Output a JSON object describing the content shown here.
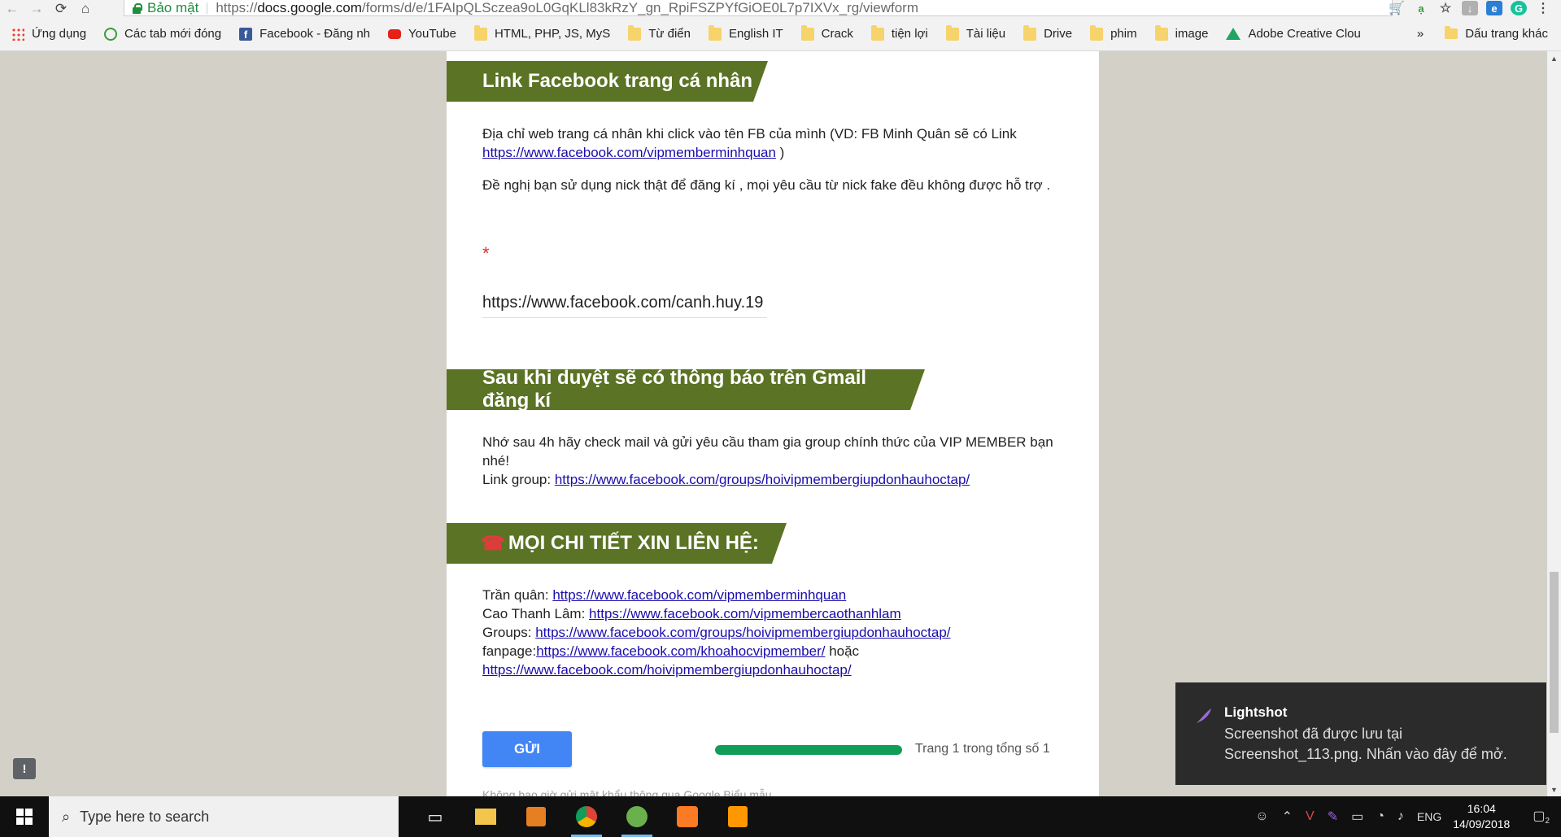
{
  "browser": {
    "secure_label": "Bảo mật",
    "url_scheme": "https://",
    "url_host": "docs.google.com",
    "url_path": "/forms/d/e/1FAIpQLSczea9oL0GqKLl83kRzY_gn_RpiFSZPYfGiOE0L7p7IXVx_rg/viewform"
  },
  "bookmarks": {
    "items": [
      "Ứng dụng",
      "Các tab mới đóng",
      "Facebook - Đăng nh",
      "YouTube",
      "HTML, PHP, JS, MyS",
      "Từ điển",
      "English IT",
      "Crack",
      "tiện lợi",
      "Tài liệu",
      "Drive",
      "phim",
      "image",
      "Adobe Creative Clou"
    ],
    "more": "»",
    "other": "Dấu trang khác"
  },
  "form": {
    "section1_title": "Link Facebook trang cá nhân",
    "section1_desc_a": " Địa chỉ web trang cá nhân khi click vào tên FB của mình (VD: FB Minh Quân  sẽ có Link ",
    "section1_link": "https://www.facebook.com/vipmemberminhquan",
    "section1_desc_b": " )",
    "section1_note": "Đề nghị bạn sử dụng nick thật để đăng kí , mọi yêu cầu từ nick fake đều không được hỗ trợ .",
    "required_mark": "*",
    "answer_value": "https://www.facebook.com/canh.huy.19",
    "section2_title": "Sau khi duyệt sẽ có thông báo trên Gmail đăng kí",
    "section2_text": "Nhớ sau 4h hãy check mail và gửi yêu cầu tham gia group chính thức của VIP MEMBER bạn nhé!",
    "section2_group_label": "Link group: ",
    "section2_group_link": "https://www.facebook.com/groups/hoivipmembergiupdonhauhoctap/",
    "section3_icon": "☎",
    "section3_title": "MỌI CHI TIẾT XIN LIÊN HỆ:",
    "contacts": [
      {
        "label": "Trần quân: ",
        "link": "https://www.facebook.com/vipmemberminhquan"
      },
      {
        "label": "Cao Thanh Lâm: ",
        "link": "https://www.facebook.com/vipmembercaothanhlam"
      },
      {
        "label": "Groups: ",
        "link": "https://www.facebook.com/groups/hoivipmembergiupdonhauhoctap/"
      },
      {
        "label": "fanpage:",
        "link": "https://www.facebook.com/khoahocvipmember/",
        "suffix": " hoặc"
      }
    ],
    "extra_link": "https://www.facebook.com/hoivipmembergiupdonhauhoctap/",
    "submit_label": "GỬI",
    "progress_fraction": 1.0,
    "progress_text": "Trang 1 trong tổng số 1",
    "footer_note": "Không bao giờ gửi mật khẩu thông qua Google Biểu mẫu."
  },
  "toast": {
    "title": "Lightshot",
    "body": "Screenshot đã được lưu tại Screenshot_113.png. Nhấn vào đây để mở."
  },
  "taskbar": {
    "search_placeholder": "Type here to search",
    "language": "ENG",
    "time": "16:04",
    "date": "14/09/2018",
    "notification_count": "2"
  },
  "colors": {
    "header_green": "#5b7324",
    "link": "#1a0dab",
    "submit_blue": "#4285f4",
    "progress_green": "#0f9d58"
  }
}
